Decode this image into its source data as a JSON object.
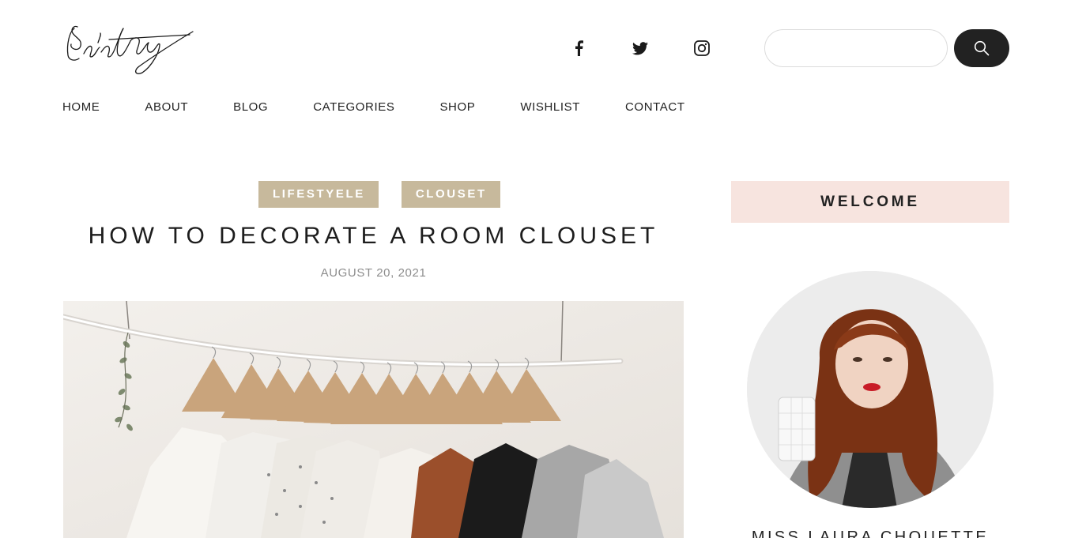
{
  "header": {
    "logo_alt": "Erin Stuy signature logo",
    "social": [
      {
        "name": "facebook-icon",
        "label": "Facebook"
      },
      {
        "name": "twitter-icon",
        "label": "Twitter"
      },
      {
        "name": "instagram-icon",
        "label": "Instagram"
      }
    ],
    "search": {
      "placeholder": "",
      "value": ""
    },
    "search_icon": "magnifier"
  },
  "nav": {
    "items": [
      "HOME",
      "ABOUT",
      "BLOG",
      "CATEGORIES",
      "SHOP",
      "WISHLIST",
      "CONTACT"
    ]
  },
  "post": {
    "categories": [
      "LIFESTYELE",
      "CLOUSET"
    ],
    "title": "HOW TO DECORATE A ROOM CLOUSET",
    "date": "AUGUST 20, 2021",
    "image_alt": "Clothes hanging on wooden hangers from a white branch rack"
  },
  "sidebar": {
    "welcome": "WELCOME",
    "author_photo_alt": "Woman with long red curly hair holding a mug",
    "author_name": "MISS LAURA CHOUETTE"
  },
  "colors": {
    "category_bg": "#c7b99c",
    "welcome_bg": "#f7e4df",
    "search_button": "#222222",
    "date_text": "#8d8d8d"
  }
}
